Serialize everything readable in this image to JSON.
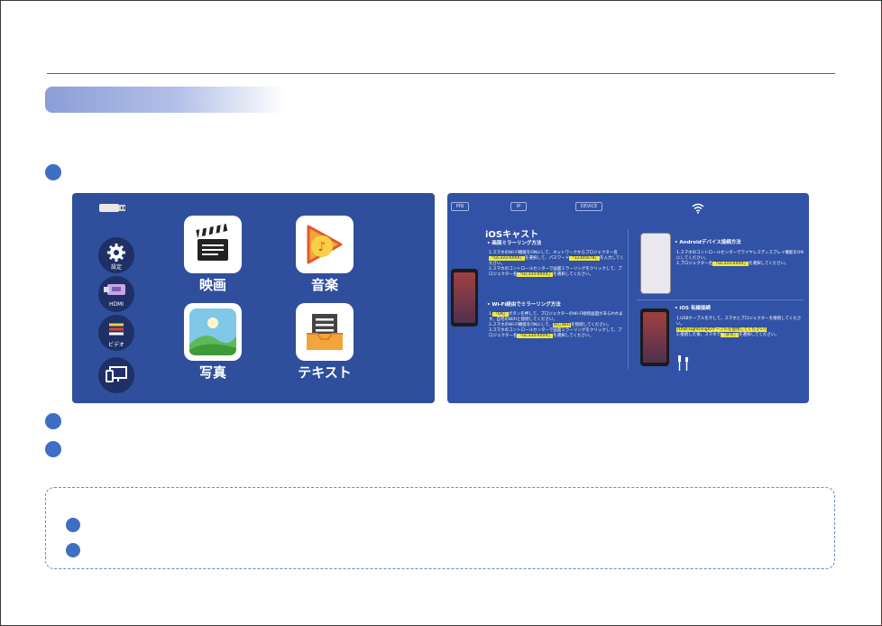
{
  "menu": {
    "tiles": [
      {
        "label": "映画",
        "icon": "movie-clapper-icon"
      },
      {
        "label": "音楽",
        "icon": "music-play-icon"
      },
      {
        "label": "写真",
        "icon": "photo-landscape-icon"
      },
      {
        "label": "テキスト",
        "icon": "document-text-icon"
      }
    ],
    "side": [
      {
        "label": "設定",
        "icon": "gear-icon"
      },
      {
        "label": "HDMI",
        "icon": "hdmi-icon"
      },
      {
        "label": "ビデオ",
        "icon": "av-cable-icon"
      },
      {
        "label": "",
        "icon": "screen-mirror-icon"
      }
    ]
  },
  "cast": {
    "top": {
      "pin": "PIN",
      "ip": "IP",
      "device": "DEVICE"
    },
    "title": "iOSキャスト",
    "s1": {
      "heading": "• 画面ミラーリング方法",
      "line1a": "1.スマホのWi-Fi機能をONにして、ネットワークからプロジェクター名",
      "line1hl": "「GC333-XXXX」",
      "line1b": "を選択して、パスワード",
      "pw": "「12345678」",
      "line1c": "を入力してください。",
      "line2a": "2.スマホのコントロールセンターで画面ミラーリングをクリックして、プロジェクター名",
      "line2hl": "「GC333-XXXX」",
      "line2b": "を選択してください。"
    },
    "s2": {
      "heading": "• Wi-Fi経由でミラーリング方法",
      "l1hl": "「OK」",
      "l1": "ボタンを押して、プロジェクターのWi-Fi接続画面があらわれます。自宅のWiFiと接続してください。",
      "l2a": "2.スマホのWi-Fi機能をONにして、",
      "l2hl": "同じWiFi",
      "l2b": "を接続してください。",
      "l3a": "3.スマホのコントロールセンターで画面ミラーリングをクリックして、プロジェクター名",
      "l3hl": "「GC333-XXXX」",
      "l3b": "を選択してください。"
    },
    "s3": {
      "heading": "• Androidデバイス接続方法",
      "l1": "1.スマホのコントロールセンターでワイヤレスディスプレイ機能をONにしてください。",
      "l2a": "2.プロジェクター名",
      "l2hl": "「GC333-XXXX」",
      "l2b": "を選択してください。"
    },
    "s4": {
      "heading": "• iOS 有線接続",
      "l1": "1.USBケーブルを介して、スマホとプロジェクターを接続してください。",
      "l1hl": "(USB-Lightningのケーブルを使用してください)",
      "l2a": "2.接続した後、スマホで",
      "l2hl": "「許可」",
      "l2b": "を選択してください。"
    }
  },
  "colors": {
    "accent": "#3f6fc4",
    "panel": "#2f4f9c",
    "highlight": "#f0e83a"
  }
}
